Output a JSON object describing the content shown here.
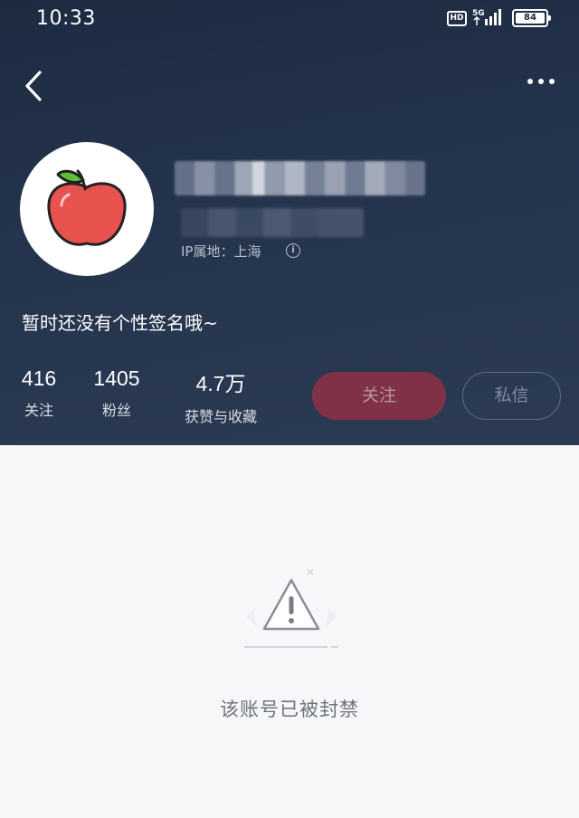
{
  "status_bar": {
    "time": "10:33",
    "hd_badge": "HD",
    "network": "5G",
    "battery": "84"
  },
  "profile": {
    "ip_location": "IP属地：上海",
    "bio": "暂时还没有个性签名哦~",
    "stats": [
      {
        "value": "416",
        "label": "关注"
      },
      {
        "value": "1405",
        "label": "粉丝"
      },
      {
        "value": "4.7万",
        "label": "获赞与收藏"
      }
    ],
    "follow_label": "关注",
    "message_label": "私信"
  },
  "empty_state": {
    "text": "该账号已被封禁"
  },
  "colors": {
    "header_bg": "#1d2b41",
    "follow_button": "#8a3147",
    "page_bg": "#f6f7f9"
  }
}
